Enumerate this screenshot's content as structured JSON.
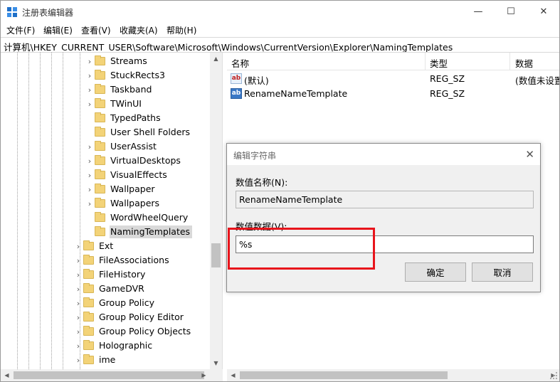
{
  "window": {
    "title": "注册表编辑器",
    "minimize_glyph": "—",
    "maximize_glyph": "☐",
    "close_glyph": "✕"
  },
  "menu": [
    "文件(F)",
    "编辑(E)",
    "查看(V)",
    "收藏夹(A)",
    "帮助(H)"
  ],
  "address": "计算机\\HKEY_CURRENT_USER\\Software\\Microsoft\\Windows\\CurrentVersion\\Explorer\\NamingTemplates",
  "tree": {
    "items": [
      {
        "label": "Streams",
        "expander": "›"
      },
      {
        "label": "StuckRects3",
        "expander": "›"
      },
      {
        "label": "Taskband",
        "expander": "›"
      },
      {
        "label": "TWinUI",
        "expander": "›"
      },
      {
        "label": "TypedPaths",
        "expander": ""
      },
      {
        "label": "User Shell Folders",
        "expander": ""
      },
      {
        "label": "UserAssist",
        "expander": "›"
      },
      {
        "label": "VirtualDesktops",
        "expander": "›"
      },
      {
        "label": "VisualEffects",
        "expander": "›"
      },
      {
        "label": "Wallpaper",
        "expander": "›"
      },
      {
        "label": "Wallpapers",
        "expander": "›"
      },
      {
        "label": "WordWheelQuery",
        "expander": ""
      },
      {
        "label": "NamingTemplates",
        "expander": "",
        "selected": true
      },
      {
        "label": "Ext",
        "expander": "›"
      },
      {
        "label": "FileAssociations",
        "expander": "›"
      },
      {
        "label": "FileHistory",
        "expander": "›"
      },
      {
        "label": "GameDVR",
        "expander": "›"
      },
      {
        "label": "Group Policy",
        "expander": "›"
      },
      {
        "label": "Group Policy Editor",
        "expander": "›"
      },
      {
        "label": "Group Policy Objects",
        "expander": "›"
      },
      {
        "label": "Holographic",
        "expander": "›"
      },
      {
        "label": "ime",
        "expander": "›"
      }
    ]
  },
  "list": {
    "headers": [
      "名称",
      "类型",
      "数据"
    ],
    "rows": [
      {
        "icon": "ab",
        "name": "(默认)",
        "type": "REG_SZ",
        "data": "(数值未设置)"
      },
      {
        "icon": "ab",
        "name": "RenameNameTemplate",
        "type": "REG_SZ",
        "data": ""
      }
    ]
  },
  "dialog": {
    "title": "编辑字符串",
    "close_glyph": "✕",
    "name_label": "数值名称(N):",
    "name_value": "RenameNameTemplate",
    "value_label": "数值数据(V):",
    "value_value": "%s",
    "ok_label": "确定",
    "cancel_label": "取消"
  },
  "scroll": {
    "up": "▲",
    "down": "▼",
    "left": "◀",
    "right": "▶"
  },
  "colors": {
    "highlight": "#e8141b",
    "folder": "#f3d378",
    "selection": "#d9d9d9"
  }
}
